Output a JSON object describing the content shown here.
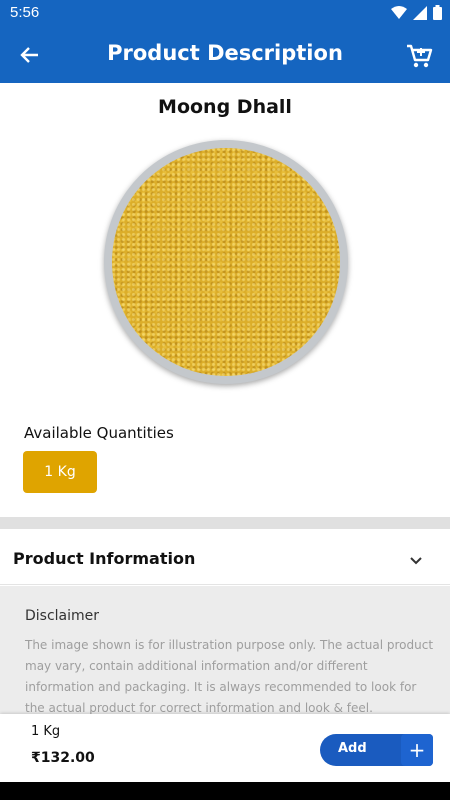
{
  "status_bar": {
    "time": "5:56"
  },
  "app_bar": {
    "title": "Product Description",
    "back_icon": "arrow-back-icon",
    "cart_icon": "cart-icon"
  },
  "product": {
    "name": "Moong Dhall",
    "image": "moong-dhall-bowl"
  },
  "quantities": {
    "label": "Available Quantities",
    "options": [
      "1 Kg"
    ],
    "selected": "1 Kg"
  },
  "product_info": {
    "title": "Product Information",
    "disclaimer_title": "Disclaimer",
    "disclaimer_text": "The image shown is for illustration purpose only. The actual product may vary, contain additional information and/or different information and packaging. It is always recommended to look for the actual product for correct information and look & feel."
  },
  "bottom_bar": {
    "quantity": "1 Kg",
    "price": "₹132.00",
    "add_label": "Add",
    "plus_label": "+"
  },
  "colors": {
    "primary": "#1565c0",
    "chip": "#dfa400",
    "add_button": "#1a5bbf"
  }
}
